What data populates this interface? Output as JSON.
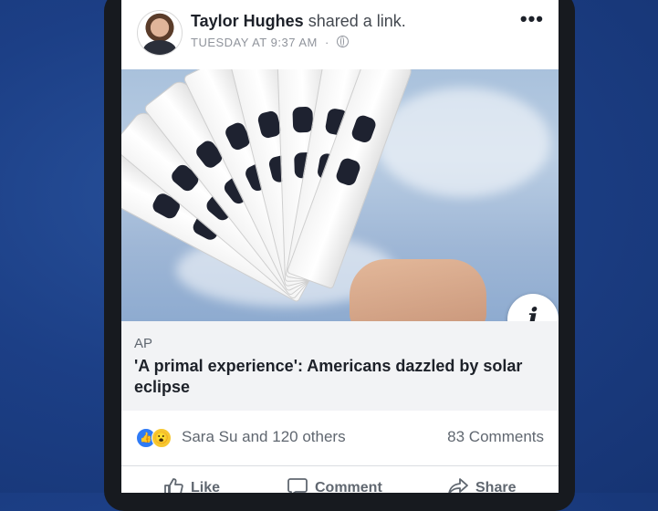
{
  "post": {
    "author": "Taylor Hughes",
    "action": "shared a link.",
    "timestamp": "TUESDAY AT 9:37 AM",
    "separator": "·",
    "privacy_icon": "globe-icon",
    "more_label": "•••"
  },
  "link": {
    "source": "AP",
    "headline": "'A primal experience': Americans dazzled by solar eclipse",
    "info_label": "i"
  },
  "reactions": {
    "icons": [
      "like-reaction-icon",
      "wow-reaction-icon"
    ],
    "like_glyph": "👍",
    "wow_glyph": "😮",
    "summary": "Sara Su and 120 others",
    "comments": "83 Comments"
  },
  "actions": {
    "like": "Like",
    "comment": "Comment",
    "share": "Share"
  },
  "colors": {
    "background": "#1c3f86",
    "like_blue": "#2f7bf6",
    "wow_yellow": "#f7c831",
    "link_panel": "#f2f3f5"
  }
}
